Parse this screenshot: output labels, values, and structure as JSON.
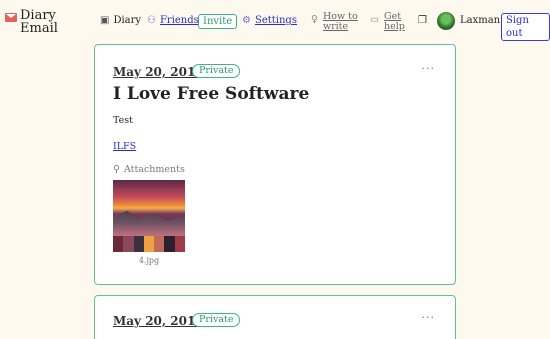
{
  "app": {
    "title_line1": "Diary",
    "title_line2": "Email"
  },
  "nav": {
    "diary": "Diary",
    "friends": "Friends",
    "invite": "Invite",
    "settings": "Settings",
    "how_to_write_1": "How to",
    "how_to_write_2": "write",
    "get_help_1": "Get",
    "get_help_2": "help",
    "username": "Laxman",
    "signout": "Sign out"
  },
  "entries": [
    {
      "date": "May 20, 2019",
      "visibility": "Private",
      "title": "I Love Free Software",
      "body": "Test",
      "link": "ILFS",
      "attachments_label": "Attachments",
      "attachment_name": "4.jpg"
    },
    {
      "date": "May 20, 2019",
      "visibility": "Private"
    }
  ],
  "colors": {
    "accent_green": "#3bb585",
    "link_blue": "#2b2bd0",
    "background": "#fdf9ee"
  }
}
